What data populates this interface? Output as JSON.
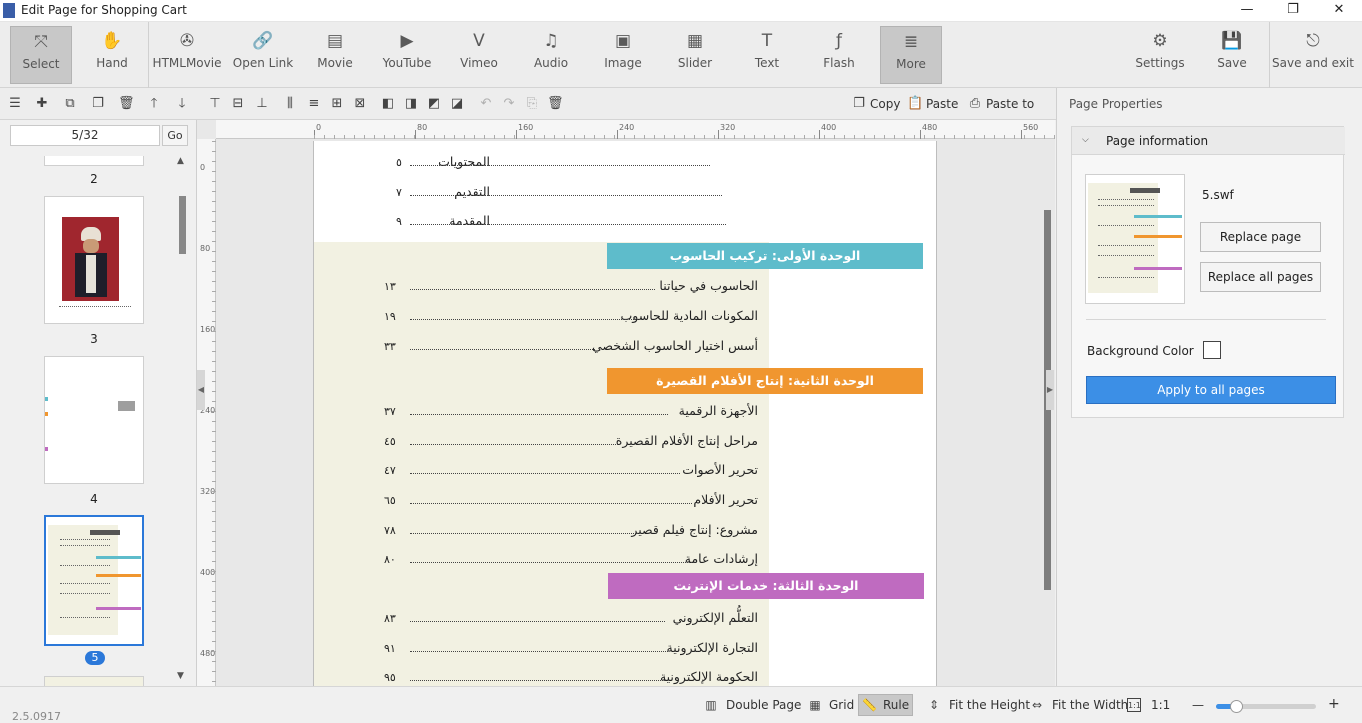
{
  "window": {
    "title": "Edit Page for Shopping Cart",
    "minimize": "—",
    "restore": "❐",
    "close": "✕"
  },
  "toolbar": {
    "items": [
      {
        "label": "Select",
        "icon": "select-arrow-icon",
        "glyph": "⤧"
      },
      {
        "label": "Hand",
        "icon": "hand-icon",
        "glyph": "✋"
      },
      {
        "label": "HTMLMovie",
        "icon": "film-reel-icon",
        "glyph": "✇"
      },
      {
        "label": "Open Link",
        "icon": "link-icon",
        "glyph": "🔗"
      },
      {
        "label": "Movie",
        "icon": "movie-icon",
        "glyph": "▤"
      },
      {
        "label": "YouTube",
        "icon": "youtube-icon",
        "glyph": "▶"
      },
      {
        "label": "Vimeo",
        "icon": "vimeo-icon",
        "glyph": "V"
      },
      {
        "label": "Audio",
        "icon": "audio-note-icon",
        "glyph": "♫"
      },
      {
        "label": "Image",
        "icon": "image-icon",
        "glyph": "▣"
      },
      {
        "label": "Slider",
        "icon": "slider-icon",
        "glyph": "▦"
      },
      {
        "label": "Text",
        "icon": "text-icon",
        "glyph": "T"
      },
      {
        "label": "Flash",
        "icon": "flash-icon",
        "glyph": "ƒ"
      },
      {
        "label": "More",
        "icon": "more-icon",
        "glyph": "≣"
      }
    ],
    "right": [
      {
        "label": "Settings",
        "icon": "gear-icon",
        "glyph": "⚙"
      },
      {
        "label": "Save",
        "icon": "save-icon",
        "glyph": "💾"
      },
      {
        "label": "Save and exit",
        "icon": "save-exit-icon",
        "glyph": "⎋"
      }
    ]
  },
  "secondary": {
    "copy": "Copy",
    "paste": "Paste",
    "paste_to": "Paste to"
  },
  "pages": {
    "current": "5/32",
    "go": "Go",
    "thumbs": [
      "2",
      "3",
      "4",
      "5"
    ],
    "selected": "5"
  },
  "document": {
    "intro": [
      {
        "title": "المحتويات",
        "page": "٥"
      },
      {
        "title": "التقديم",
        "page": "٧"
      },
      {
        "title": "المقدمة",
        "page": "٩"
      }
    ],
    "units": [
      {
        "title": "الوحدة الأولى: تركيب الحاسوب",
        "color": "#5ebccb",
        "items": [
          {
            "title": "الحاسوب في حياتنا",
            "page": "١٣"
          },
          {
            "title": "المكونات المادية للحاسوب",
            "page": "١٩"
          },
          {
            "title": "أسس اختيار الحاسوب الشخصي",
            "page": "٣٣"
          }
        ]
      },
      {
        "title": "الوحدة الثانية: إنتاج الأفلام القصيرة",
        "color": "#f0962f",
        "items": [
          {
            "title": "الأجهزة الرقمية",
            "page": "٣٧"
          },
          {
            "title": "مراحل إنتاج الأفلام القصيرة",
            "page": "٤٥"
          },
          {
            "title": "تحرير الأصوات",
            "page": "٤٧"
          },
          {
            "title": "تحرير الأفلام",
            "page": "٦٥"
          },
          {
            "title": "مشروع: إنتاج فيلم قصير",
            "page": "٧٨"
          },
          {
            "title": "إرشادات عامة",
            "page": "٨٠"
          }
        ]
      },
      {
        "title": "الوحدة الثالثة: خدمات الإنترنت",
        "color": "#bf6bc0",
        "items": [
          {
            "title": "التعلُّم الإلكتروني",
            "page": "٨٣"
          },
          {
            "title": "التجارة الإلكترونية",
            "page": "٩١"
          },
          {
            "title": "الحكومة الإلكترونية",
            "page": "٩٥"
          }
        ]
      }
    ]
  },
  "ruler": {
    "h": [
      "0",
      "80",
      "160",
      "240",
      "320",
      "400",
      "480",
      "560"
    ],
    "v": [
      "0",
      "80",
      "160",
      "240",
      "320",
      "400",
      "480"
    ]
  },
  "properties": {
    "panel_title": "Page Properties",
    "section": "Page information",
    "file": "5.swf",
    "replace_page": "Replace page",
    "replace_all": "Replace all pages",
    "bg_label": "Background Color",
    "apply_all": "Apply to all pages"
  },
  "status": {
    "version": "2.5.0917",
    "double_page": "Double Page",
    "grid": "Grid",
    "rule": "Rule",
    "fit_height": "Fit the Height",
    "fit_width": "Fit the Width",
    "actual": "1:1",
    "minus": "—",
    "plus": "+",
    "zoom_fraction": 0.2
  }
}
